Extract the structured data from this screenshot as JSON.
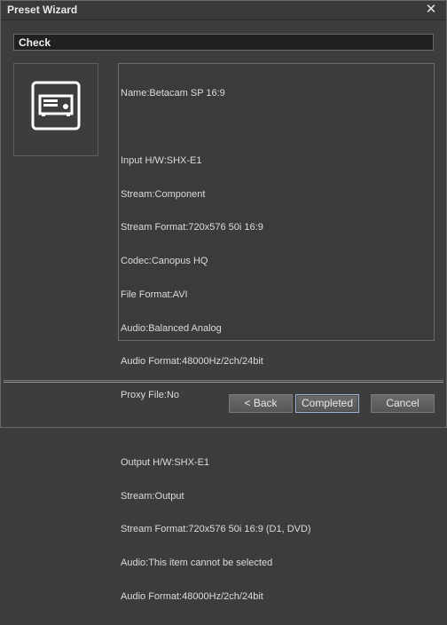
{
  "window": {
    "title": "Preset Wizard",
    "close_glyph": "✕"
  },
  "section": {
    "label": "Check"
  },
  "icon": {
    "name": "deck-device-icon",
    "color": "#ffffff"
  },
  "info": {
    "lines": [
      "Name:Betacam SP 16:9",
      "",
      "Input H/W:SHX-E1",
      "Stream:Component",
      "Stream Format:720x576 50i 16:9",
      "Codec:Canopus HQ",
      "File Format:AVI",
      "Audio:Balanced Analog",
      "Audio Format:48000Hz/2ch/24bit",
      "Proxy File:No",
      "",
      "Output H/W:SHX-E1",
      "Stream:Output",
      "Stream Format:720x576 50i 16:9 (D1, DVD)",
      "Audio:This item cannot be selected",
      "Audio Format:48000Hz/2ch/24bit"
    ]
  },
  "buttons": {
    "back_label": "< Back",
    "completed_label": "Completed",
    "cancel_label": "Cancel"
  }
}
